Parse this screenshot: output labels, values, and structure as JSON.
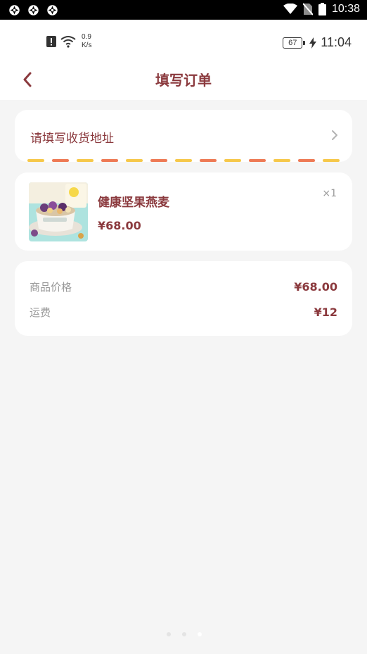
{
  "system_status": {
    "time": "10:38",
    "notification_icons": [
      "app-notification-icon",
      "app-notification-icon",
      "app-notification-icon"
    ],
    "status_icons": [
      "wifi-icon",
      "no-sim-icon",
      "battery-icon"
    ]
  },
  "app_status": {
    "network_speed_value": "0.9",
    "network_speed_unit": "K/s",
    "battery_level": "67",
    "clock": "11:04"
  },
  "nav": {
    "title": "填写订单",
    "back_icon": "chevron-left-icon"
  },
  "address": {
    "placeholder_text": "请填写收货地址",
    "stripe_colors": [
      "#f6c84a",
      "#ee7a55"
    ]
  },
  "product": {
    "name": "健康坚果燕麦",
    "price": "¥68.00",
    "quantity": "×1",
    "image": "oatmeal-bowl-photo"
  },
  "summary": {
    "rows": [
      {
        "label": "商品价格",
        "value": "¥68.00"
      },
      {
        "label": "运费",
        "value": "¥12"
      }
    ]
  },
  "colors": {
    "accent": "#8b3a3e",
    "background": "#f5f5f5",
    "muted_text": "#999999"
  },
  "pager": {
    "page_count": 3,
    "active_index": 2
  }
}
